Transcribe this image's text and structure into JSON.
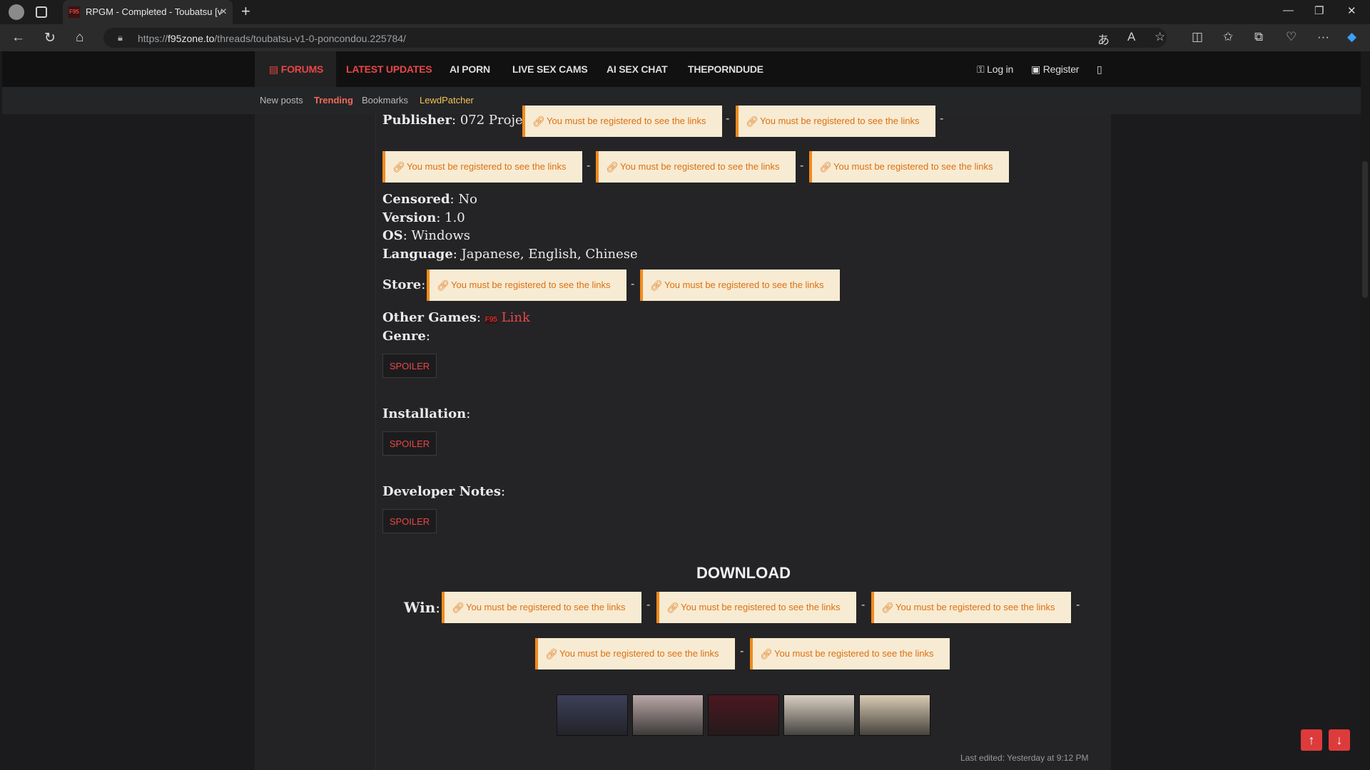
{
  "browser": {
    "tab_title": "RPGM - Completed - Toubatsu [v",
    "tab_favicon_text": "F95",
    "url_prefix": "https://",
    "url_domain": "f95zone.to",
    "url_path": "/threads/toubatsu-v1-0-poncondou.225784/"
  },
  "nav_primary": {
    "forums": "FORUMS",
    "latest_updates": "LATEST UPDATES",
    "ai_porn": "AI PORN",
    "live_sex_cams": "LIVE SEX CAMS",
    "ai_sex_chat": "AI SEX CHAT",
    "theporndude": "THEPORNDUDE",
    "login": "Log in",
    "register": "Register"
  },
  "nav_secondary": {
    "new_posts": "New posts",
    "trending": "Trending",
    "bookmarks": "Bookmarks",
    "lewdpatcher": "LewdPatcher"
  },
  "link_text": "You must be registered to see the links",
  "post": {
    "publisher_label": "Publisher",
    "publisher_value": "072 Project",
    "censored_label": "Censored",
    "censored_value": "No",
    "version_label": "Version",
    "version_value": "1.0",
    "os_label": "OS",
    "os_value": "Windows",
    "language_label": "Language",
    "language_value": "Japanese, English, Chinese",
    "store_label": "Store",
    "other_games_label": "Other Games",
    "other_games_icon": "F95",
    "other_games_link": "Link",
    "genre_label": "Genre",
    "installation_label": "Installation",
    "developer_notes_label": "Developer Notes",
    "spoiler_label": "SPOILER",
    "download_heading": "DOWNLOAD",
    "win_label": "Win",
    "last_edited": "Last edited: Yesterday at 9:12 PM"
  },
  "thumb_colors": [
    "#3d3f59",
    "#b8a7a6",
    "#4a1820",
    "#d8cfc1",
    "#d9cbb4"
  ],
  "colors": {
    "accent": "#e94646",
    "link_box": "#f7ebd3",
    "link_border": "#f28a1c"
  }
}
